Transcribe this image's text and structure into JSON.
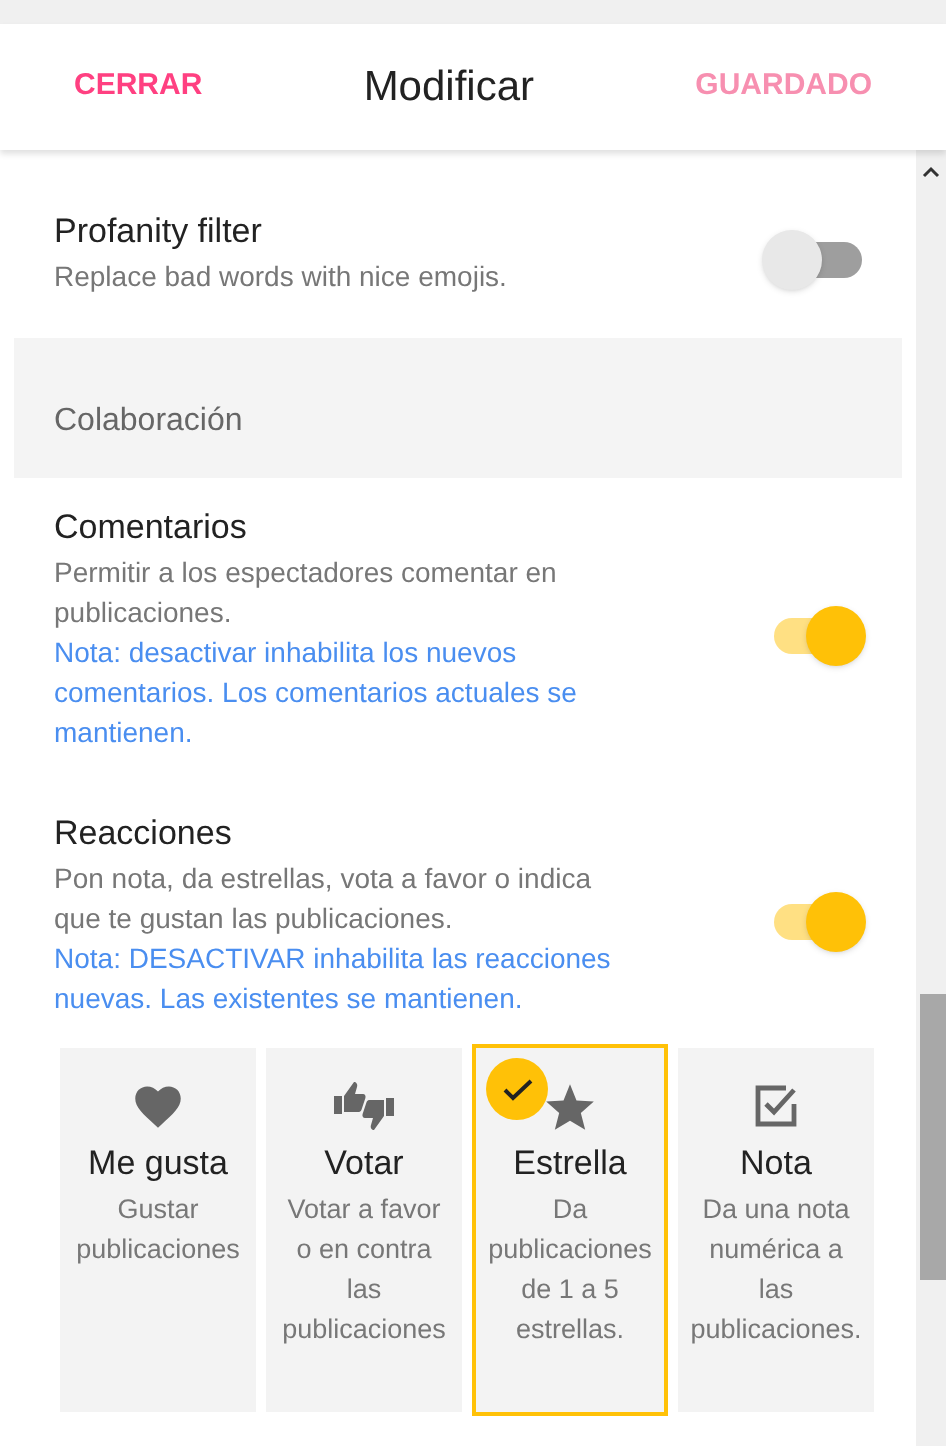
{
  "header": {
    "close": "CERRAR",
    "title": "Modificar",
    "save": "GUARDADO",
    "save_disabled": true
  },
  "settings": [
    {
      "kind": "toggle",
      "title": "Profanity filter",
      "description": "Replace bad words with nice emojis.",
      "on": false
    }
  ],
  "section": {
    "title": "Colaboración",
    "settings": [
      {
        "kind": "toggle",
        "title": "Comentarios",
        "description": "Permitir a los espectadores comentar en publicaciones.",
        "note": "Nota: desactivar inhabilita los nuevos comentarios. Los comentarios actuales se mantienen.",
        "on": true
      },
      {
        "kind": "toggle",
        "title": "Reacciones",
        "description": "Pon nota, da estrellas, vota a favor o indica que te gustan las publicaciones.",
        "note": "Nota: DESACTIVAR inhabilita las reacciones nuevas. Las existentes se mantienen.",
        "on": true
      }
    ]
  },
  "reaction_types": [
    {
      "kind": "heart",
      "label": "Me gusta",
      "description": "Gustar publicaciones",
      "selected": false
    },
    {
      "kind": "thumbs",
      "label": "Votar",
      "description": "Votar a favor o en contra las publicaciones",
      "selected": false
    },
    {
      "kind": "star",
      "label": "Estrella",
      "description": "Da publicaciones de 1 a 5 estrellas.",
      "selected": true
    },
    {
      "kind": "checkbox",
      "label": "Nota",
      "description": "Da una nota numérica a las publicaciones.",
      "selected": false
    }
  ]
}
